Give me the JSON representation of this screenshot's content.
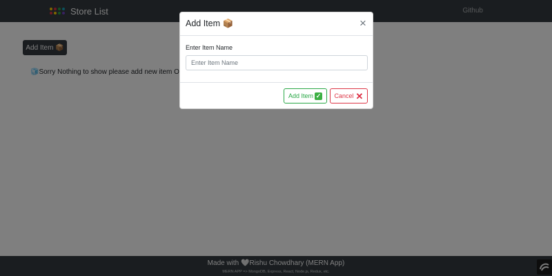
{
  "navbar": {
    "brand": "Store List",
    "link": "Github",
    "logo_colors": [
      "#ffcc00",
      "#dc3545",
      "#28a745",
      "#17a2b8",
      "#dc3545",
      "#ffcc00",
      "#28a745",
      "#6f42c1"
    ]
  },
  "page": {
    "add_button": "Add Item 📦",
    "empty_message": "🧊Sorry Nothing to show please add new item Or",
    "empty_icon": "❗"
  },
  "modal": {
    "title": "Add Item 📦",
    "close": "×",
    "label": "Enter Item Name",
    "placeholder": "Enter Item Name",
    "add_button": "Add Item",
    "add_icon": "✓",
    "cancel_button": "Cancel",
    "cancel_icon": "✕"
  },
  "footer": {
    "main": "Made with 🤍Rishu Chowdhary (MERN App)",
    "sub": "MERN APP => MongoDB, Express, React, Node.js, Redux, etc."
  }
}
